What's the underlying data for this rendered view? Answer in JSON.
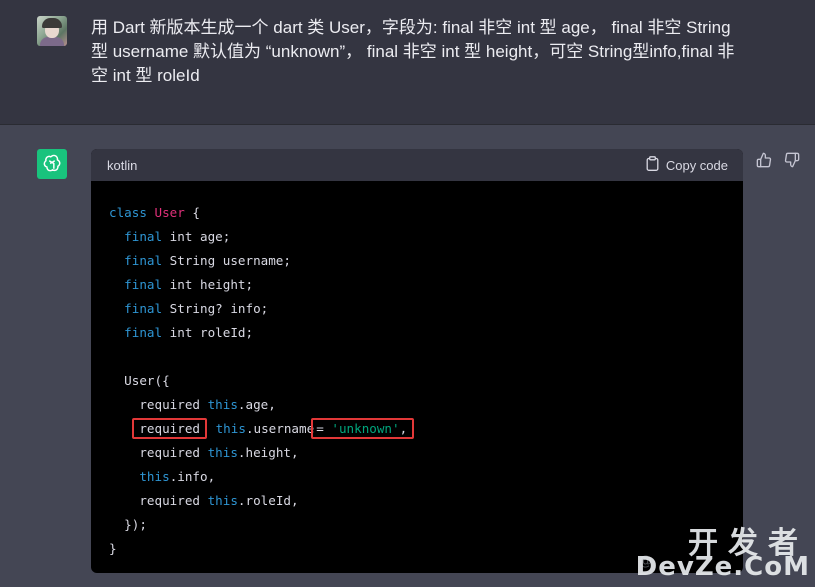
{
  "user_message": {
    "text": "用 Dart 新版本生成一个 dart 类 User，字段为: final 非空 int 型 age， final 非空 String\n型 username 默认值为 “unknown”， final 非空 int 型 height，可空 String型info,final 非\n空 int 型 roleId"
  },
  "code_block": {
    "language": "kotlin",
    "copy_label": "Copy code",
    "lines": {
      "l1": {
        "a": "class ",
        "b": "User",
        "c": " {"
      },
      "l2": {
        "a": "  final",
        "b": " int age;"
      },
      "l3": {
        "a": "  final",
        "b": " String username;"
      },
      "l4": {
        "a": "  final",
        "b": " int height;"
      },
      "l5": {
        "a": "  final",
        "b": " String? info;"
      },
      "l6": {
        "a": "  final",
        "b": " int roleId;"
      },
      "l8": {
        "a": "  User({"
      },
      "l9": {
        "a": "    required ",
        "b": "this",
        "c": ".age,"
      },
      "l10": {
        "a": "required",
        "b": " this",
        "c": ".username",
        "d": "= ",
        "e": "'unknown'",
        "f": ","
      },
      "l11": {
        "a": "    required ",
        "b": "this",
        "c": ".height,"
      },
      "l12": {
        "a": "    ",
        "b": "this",
        "c": ".info,"
      },
      "l13": {
        "a": "    required ",
        "b": "this",
        "c": ".roleId,"
      },
      "l14": {
        "a": "  });"
      },
      "l15": {
        "a": "}"
      }
    }
  },
  "icons": {
    "assistant_avatar": "openai-logo-icon",
    "copy": "clipboard-icon",
    "thumbs_up": "thumbs-up-icon",
    "thumbs_down": "thumbs-down-icon"
  },
  "watermark": {
    "top": "开发者",
    "bottom": "DevZe.CoM",
    "faint": "@"
  },
  "colors": {
    "background": "#444654",
    "user_background": "#343541",
    "assistant_avatar": "#19c37d",
    "keyword": "#2e95d3",
    "class_name": "#df3079",
    "string": "#00a67d",
    "highlight_box": "#e23838"
  }
}
